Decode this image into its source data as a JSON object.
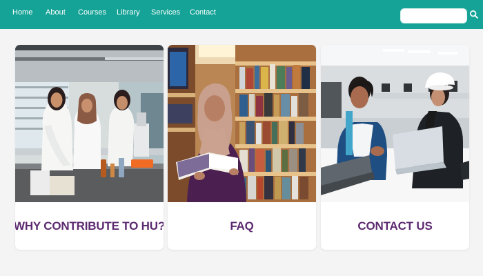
{
  "nav": {
    "links": [
      {
        "label": "Home"
      },
      {
        "label": "About"
      },
      {
        "label": "Courses"
      },
      {
        "label": "Library"
      },
      {
        "label": "Services"
      },
      {
        "label": "Contact"
      }
    ],
    "search": {
      "placeholder": ""
    }
  },
  "cards": [
    {
      "title": "WHY CONTRIBUTE TO HU?",
      "image": "lab-students-photo"
    },
    {
      "title": "FAQ",
      "image": "library-reading-photo"
    },
    {
      "title": "CONTACT US",
      "image": "students-laptop-photo"
    }
  ],
  "colors": {
    "nav_bg": "#14a396",
    "title_text": "#5c2a70",
    "page_bg": "#f4f4f4",
    "card_bg": "#ffffff"
  },
  "icons": {
    "search": "search-icon"
  }
}
